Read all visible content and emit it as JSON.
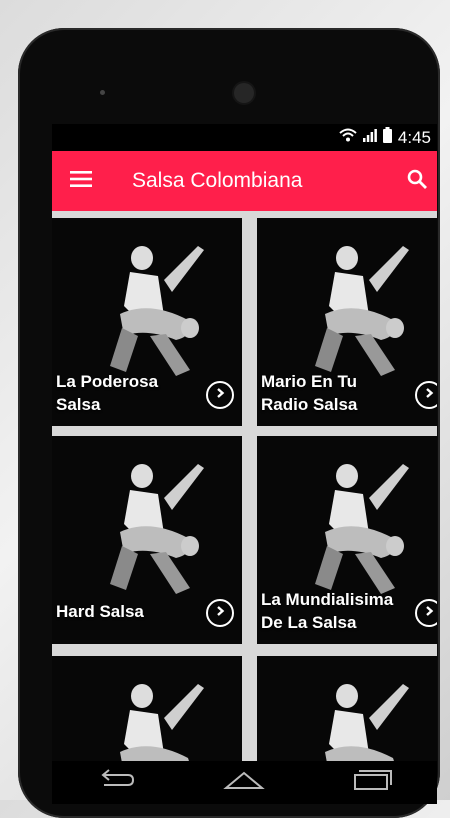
{
  "status": {
    "time": "4:45",
    "icons": [
      "wifi-icon",
      "signal-icon",
      "battery-icon"
    ]
  },
  "appbar": {
    "title": "Salsa Colombiana",
    "menu_icon": "menu-icon",
    "search_icon": "search-icon"
  },
  "stations": [
    {
      "name_line1": "La Poderosa",
      "name_line2": "Salsa"
    },
    {
      "name_line1": "Mario En Tu",
      "name_line2": "Radio Salsa"
    },
    {
      "name_line1": "Hard Salsa",
      "name_line2": ""
    },
    {
      "name_line1": "La Mundialisima",
      "name_line2": "De La Salsa"
    },
    {
      "name_line1": "",
      "name_line2": ""
    },
    {
      "name_line1": "",
      "name_line2": ""
    }
  ],
  "navbar": {
    "icons": [
      "back-icon",
      "home-icon",
      "recents-icon"
    ]
  },
  "colors": {
    "accent": "#ff1f4b",
    "card_bg": "#070707",
    "status_bg": "#000000"
  }
}
